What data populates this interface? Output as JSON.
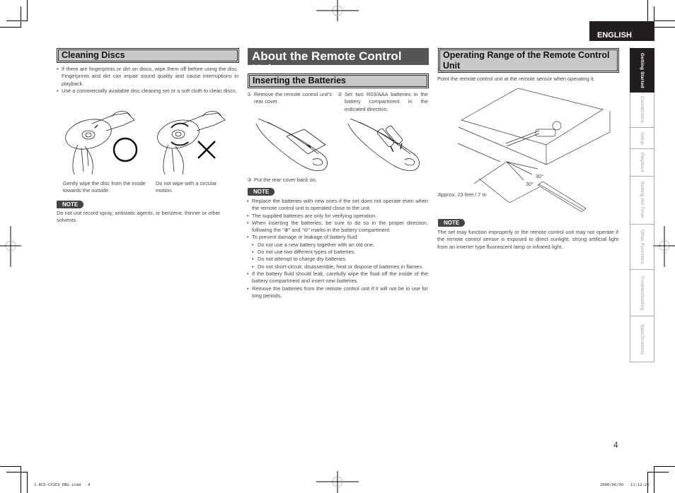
{
  "language_tab": "ENGLISH",
  "page_number": "4",
  "footer": {
    "file": "1.RCD-CX1E3_ENG.indd   4",
    "timestamp": "2008/06/30   11:12:26"
  },
  "side_tabs": [
    {
      "label": "Getting Started",
      "active": true
    },
    {
      "label": "Connections",
      "active": false
    },
    {
      "label": "Setup",
      "active": false
    },
    {
      "label": "Playback",
      "active": false
    },
    {
      "label": "Setting the Timer",
      "active": false
    },
    {
      "label": "Other Functions",
      "active": false
    },
    {
      "label": "Troubleshooting",
      "active": false
    },
    {
      "label": "Specifications",
      "active": false
    }
  ],
  "cleaning": {
    "heading": "Cleaning Discs",
    "bullets": [
      "If there are fingerprints or dirt on discs, wipe them off before using the disc. Fingerprints and dirt can impair sound quality and cause interruptions in playback.",
      "Use a commercially available disc cleaning set or a soft cloth to clean discs."
    ],
    "caption_ok": "Gently wipe the disc from the inside towards the outside.",
    "caption_ng": "Do not wipe with a circular motion.",
    "note_label": "NOTE",
    "note_text": "Do not use record spray, antistatic agents, or benzene, thinner or other solvents."
  },
  "remote": {
    "heading": "About the Remote Control Unit",
    "sub_heading": "Inserting the Batteries",
    "steps": [
      {
        "num": "①",
        "text": "Remove the remote control unit’s rear cover."
      },
      {
        "num": "②",
        "text": "Set two R03/AAA batteries in the battery compartment in the indicated direction."
      },
      {
        "num": "③",
        "text": "Put the rear cover back on."
      }
    ],
    "note_label": "NOTE",
    "notes": [
      {
        "text": "Replace the batteries with new ones if the set does not operate even when the remote control unit is operated close to the unit.",
        "sub": false
      },
      {
        "text": "The supplied batteries are only for verifying operation.",
        "sub": false
      },
      {
        "text": "When inserting the batteries, be sure to do so in the proper direction, following the “⊕” and “⊖” marks in the battery compartment.",
        "sub": false
      },
      {
        "text": "To prevent damage or leakage of battery fluid:",
        "sub": false
      },
      {
        "text": "Do not use a new battery together with an old one.",
        "sub": true
      },
      {
        "text": "Do not use two different types of batteries.",
        "sub": true
      },
      {
        "text": "Do not attempt to charge dry batteries.",
        "sub": true
      },
      {
        "text": "Do not short-circuit, disassemble, heat or dispose of batteries in flames.",
        "sub": true
      },
      {
        "text": "If the battery fluid should leak, carefully wipe the fluid off the inside of the battery compartment and insert new batteries.",
        "sub": false
      },
      {
        "text": "Remove the batteries from the remote control unit if it will not be in use for long periods.",
        "sub": false
      }
    ]
  },
  "range": {
    "heading": "Operating Range of the Remote Control Unit",
    "intro": "Point the remote control unit at the remote sensor when operating it.",
    "distance_label": "Approx. 23 feet / 7 m",
    "angle_upper": "30°",
    "angle_lower": "30°",
    "note_label": "NOTE",
    "note_text": "The set may function improperly or the remote control unit may not operate if the remote control sensor is exposed to direct sunlight, strong artificial light from an inverter type fluorescent lamp or infrared light."
  }
}
